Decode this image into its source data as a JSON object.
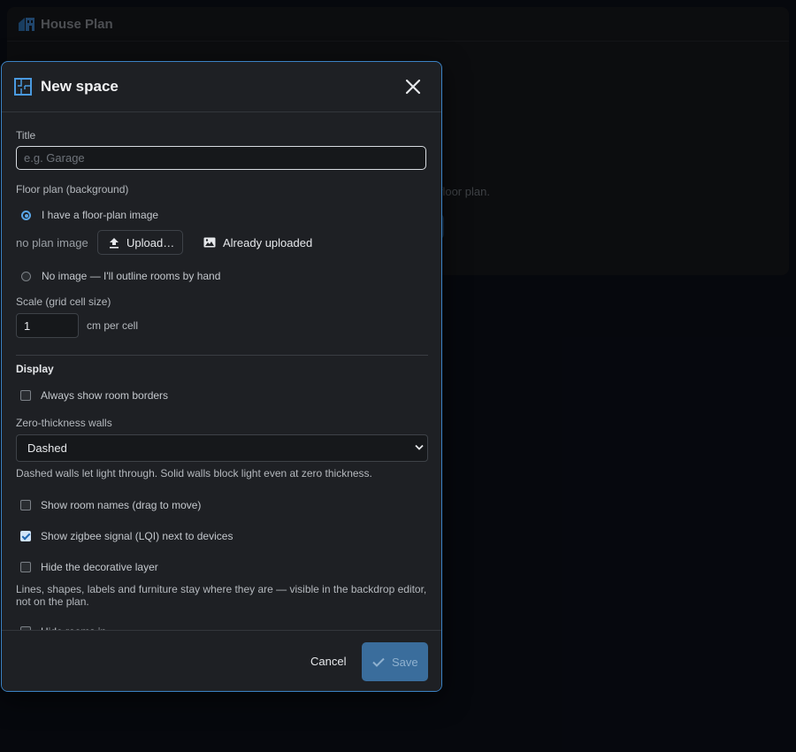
{
  "app": {
    "title": "House Plan",
    "hint_text": "a floor plan."
  },
  "dialog": {
    "title": "New space",
    "title_field": {
      "label": "Title",
      "placeholder": "e.g. Garage",
      "value": ""
    },
    "floor_plan": {
      "label": "Floor plan (background)",
      "option_image": "I have a floor-plan image",
      "no_plan_text": "no plan image",
      "upload_label": "Upload…",
      "already_uploaded_label": "Already uploaded",
      "option_no_image": "No image — I'll outline rooms by hand"
    },
    "scale": {
      "label": "Scale (grid cell size)",
      "value": "1",
      "unit": "cm per cell"
    },
    "display": {
      "title": "Display",
      "always_show_borders": "Always show room borders",
      "walls_label": "Zero-thickness walls",
      "walls_value": "Dashed",
      "walls_help": "Dashed walls let light through. Solid walls block light even at zero thickness.",
      "show_room_names": "Show room names (drag to move)",
      "show_zigbee": "Show zigbee signal (LQI) next to devices",
      "hide_decorative": "Hide the decorative layer",
      "decorative_help": "Lines, shapes, labels and furniture stay where they are — visible in the backdrop editor, not on the plan.",
      "cut_off_item": "Hide rooms in..."
    },
    "footer": {
      "cancel": "Cancel",
      "save": "Save"
    }
  },
  "colors": {
    "accent": "#5aa6e8",
    "dialog_bg": "#1e2024",
    "save_bg": "#3a6d9c"
  }
}
